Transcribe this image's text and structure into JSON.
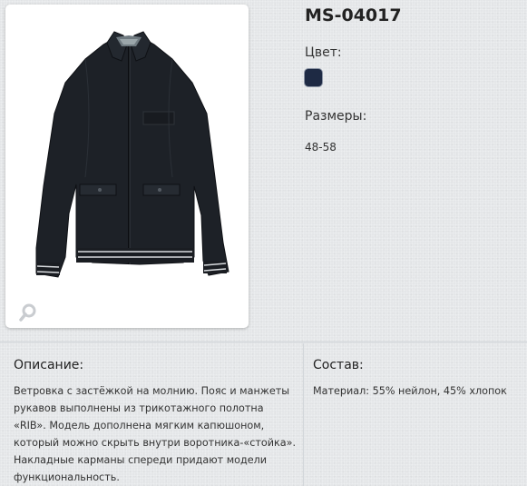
{
  "product": {
    "title": "MS-04017",
    "image_alt_icon": "jacket-photo",
    "zoom_icon": "magnifier-icon"
  },
  "color": {
    "label": "Цвет:",
    "swatch_color": "#1e2a44"
  },
  "sizes": {
    "label": "Размеры:",
    "value": "48-58"
  },
  "description": {
    "title": "Описание:",
    "text": "Ветровка с застёжкой на молнию. Пояс и манжеты рукавов выполнены из трикотажного полотна «RIB». Модель дополнена мягким капюшоном, который можно скрыть внутри воротника-«стойка». Накладные карманы спереди придают модели функциональность."
  },
  "composition": {
    "title": "Состав:",
    "text": "Материал: 55% нейлон, 45% хлопок"
  }
}
